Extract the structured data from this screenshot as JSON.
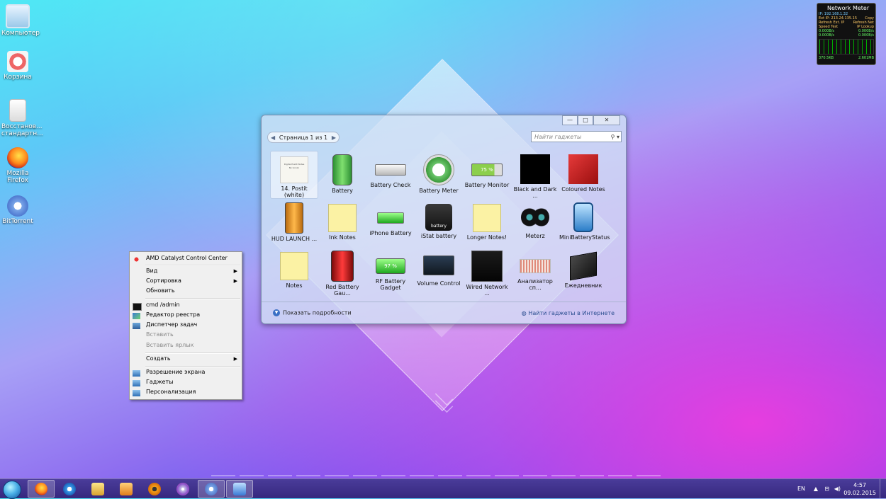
{
  "desktop": {
    "icons": [
      {
        "label": "Компьютер"
      },
      {
        "label": "Корзина"
      },
      {
        "label": "Восстанов... стандартн..."
      },
      {
        "label": "Mozilla Firefox"
      },
      {
        "label": "BitTorrent"
      }
    ]
  },
  "network_meter": {
    "title": "Network Meter",
    "ip": "IP: 192.168.1.32",
    "ext_ip": "Ext IP: 213.24.135.15",
    "copy": "Copy",
    "refresh_ext": "Refresh Ext. IP",
    "refresh_net": "Refresh Net",
    "speed_test": "Speed Test",
    "ip_lookup": "IP Lookup",
    "up1": "0.000B/s",
    "up2": "0.000B/s",
    "down1": "0.000B/s",
    "down2": "0.000B/s",
    "total_up": "370.5KB",
    "total_down": "2.601MB"
  },
  "gadget_window": {
    "pager_label": "Страница 1 из 1",
    "search_placeholder": "Найти гаджеты",
    "show_details": "Показать подробности",
    "find_online": "Найти гаджеты в Интернете",
    "gadgets": [
      {
        "label": "14. Postit (white)",
        "color": "#f4f4ef"
      },
      {
        "label": "Battery",
        "color": "#45b84a"
      },
      {
        "label": "Battery Check",
        "color": "#d8d8d8"
      },
      {
        "label": "Battery Meter",
        "color": "#5fc15f"
      },
      {
        "label": "Battery Monitor",
        "color": "#9ad35a"
      },
      {
        "label": "Black and Dark ...",
        "color": "#000000"
      },
      {
        "label": "Coloured Notes",
        "color": "#c01818"
      },
      {
        "label": "HUD LAUNCH ...",
        "color": "#e89520"
      },
      {
        "label": "Ink Notes",
        "color": "#fbf2a4"
      },
      {
        "label": "iPhone Battery",
        "color": "#3ed43e"
      },
      {
        "label": "iStat battery",
        "color": "#2a2a2a"
      },
      {
        "label": "Longer Notes!",
        "color": "#fbf2a4"
      },
      {
        "label": "Meterz",
        "color": "#1a1a1a"
      },
      {
        "label": "MiniBatteryStatus",
        "color": "#3b8fd6"
      },
      {
        "label": "Notes",
        "color": "#fbf2a4"
      },
      {
        "label": "Red Battery Gau...",
        "color": "#c81a1a"
      },
      {
        "label": "RF Battery Gadget",
        "color": "#3ecf3e"
      },
      {
        "label": "Volume Control",
        "color": "#22313f"
      },
      {
        "label": "Wired Network ...",
        "color": "#1b1b1b"
      },
      {
        "label": "Анализатор сп...",
        "color": "#e9d2c8"
      },
      {
        "label": "Ежедневник",
        "color": "#2b2b2b"
      }
    ],
    "icon_text": {
      "postit_line1": "Digital Postit Notes",
      "postit_line2": "By Gonzo",
      "battery_monitor_pct": "75 %",
      "istat": "battery",
      "rf_pct": "97 %"
    }
  },
  "context_menu": {
    "items": [
      {
        "label": "AMD Catalyst Control Center",
        "disabled": false,
        "submenu": false
      },
      {
        "label": "Вид",
        "disabled": false,
        "submenu": true
      },
      {
        "label": "Сортировка",
        "disabled": false,
        "submenu": true
      },
      {
        "label": "Обновить",
        "disabled": false,
        "submenu": false
      },
      {
        "label": "cmd /admin",
        "disabled": false,
        "submenu": false
      },
      {
        "label": "Редактор реестра",
        "disabled": false,
        "submenu": false
      },
      {
        "label": "Диспетчер задач",
        "disabled": false,
        "submenu": false
      },
      {
        "label": "Вставить",
        "disabled": true,
        "submenu": false
      },
      {
        "label": "Вставить ярлык",
        "disabled": true,
        "submenu": false
      },
      {
        "label": "Создать",
        "disabled": false,
        "submenu": true
      },
      {
        "label": "Разрешение экрана",
        "disabled": false,
        "submenu": false
      },
      {
        "label": "Гаджеты",
        "disabled": false,
        "submenu": false
      },
      {
        "label": "Персонализация",
        "disabled": false,
        "submenu": false
      }
    ]
  },
  "taskbar": {
    "lang": "EN",
    "time": "4:57",
    "date": "09.02.2015"
  }
}
